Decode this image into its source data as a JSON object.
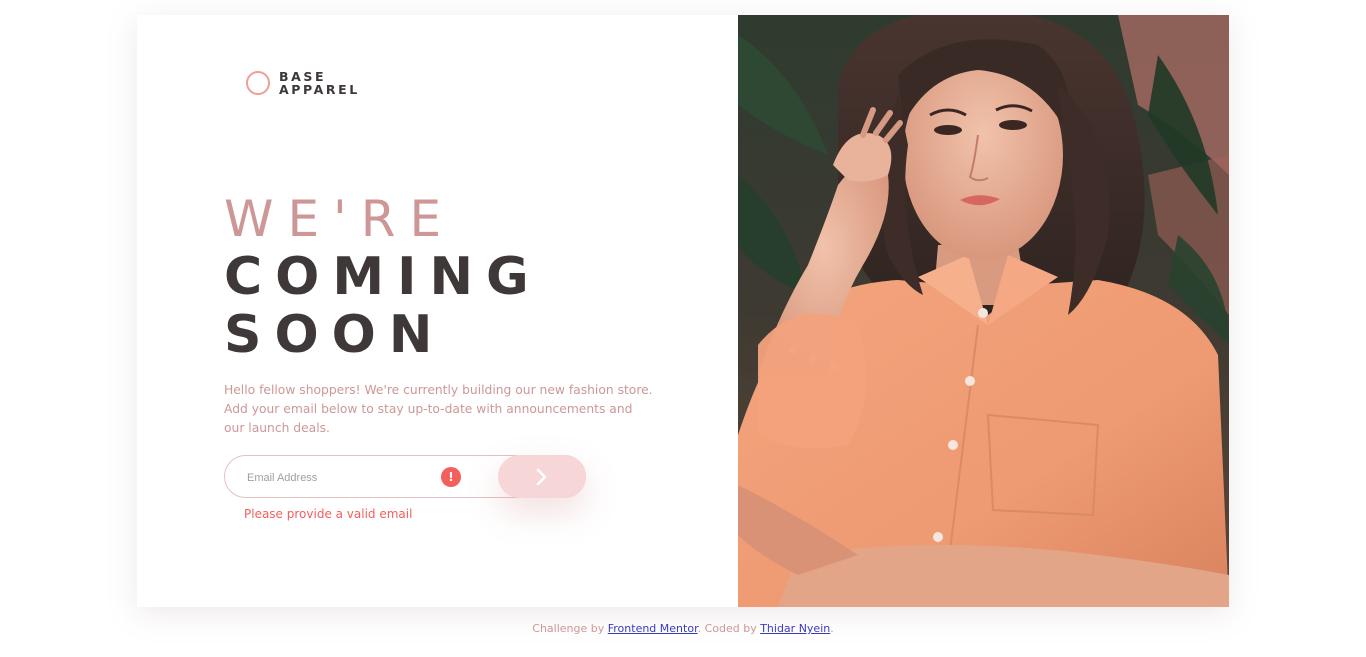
{
  "brand": {
    "line1": "BASE",
    "line2": "APPAREL",
    "accent_color": "#ef9e98"
  },
  "headline": {
    "line1": "WE'RE",
    "line2": "COMING",
    "line3": "SOON"
  },
  "description": "Hello fellow shoppers! We're currently building our new fashion store. Add your email below to stay up-to-date with announcements and our launch deals.",
  "form": {
    "email_placeholder": "Email Address",
    "error_icon": "exclamation-icon",
    "error_glyph": "!",
    "submit_icon": "chevron-right-icon",
    "error_message": "Please provide a valid email"
  },
  "hero_image": {
    "description": "Woman with wavy brown hair wearing a peach button-up shirt and charm bracelet, posing against dark tropical foliage"
  },
  "footer": {
    "prefix": "Challenge by ",
    "link1": "Frontend Mentor",
    "middle": ". Coded by ",
    "link2": "Thidar Nyein",
    "suffix": "."
  },
  "colors": {
    "pink_text": "#ce9797",
    "dark_text": "#3e3838",
    "error": "#f25f5c",
    "button_bg": "#f6d6d6",
    "link": "#3b3bbf"
  }
}
